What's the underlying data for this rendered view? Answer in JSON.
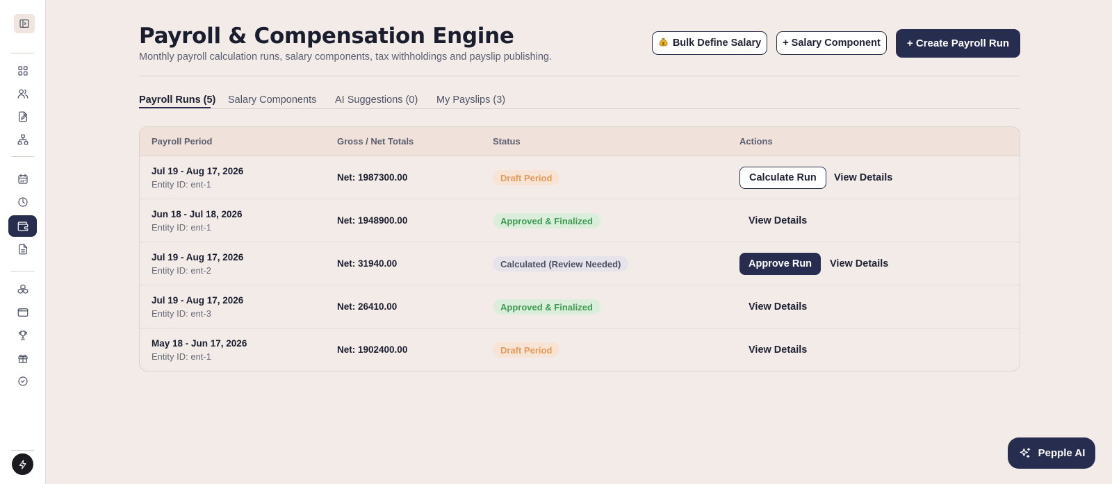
{
  "header": {
    "title": "Payroll & Compensation Engine",
    "subtitle": "Monthly payroll calculation runs, salary components, tax withholdings and payslip publishing.",
    "bulk_define_label": "Bulk Define Salary",
    "bulk_define_icon": "money-bag-icon",
    "salary_component_label": "+ Salary Component",
    "create_run_label": "+ Create Payroll Run"
  },
  "tabs": [
    {
      "label": "Payroll Runs (5)",
      "active": true
    },
    {
      "label": "Salary Components",
      "active": false
    },
    {
      "label": "AI Suggestions (0)",
      "active": false
    },
    {
      "label": "My Payslips (3)",
      "active": false
    }
  ],
  "table": {
    "columns": [
      "Payroll Period",
      "Gross / Net Totals",
      "Status",
      "Actions"
    ],
    "rows": [
      {
        "period": "Jul 19 - Aug 17, 2026",
        "entity": "Entity ID: ent-1",
        "net": "Net: 1987300.00",
        "status": "Draft Period",
        "primary_action": "Calculate Run",
        "view": "View Details"
      },
      {
        "period": "Jun 18 - Jul 18, 2026",
        "entity": "Entity ID: ent-1",
        "net": "Net: 1948900.00",
        "status": "Approved & Finalized",
        "view": "View Details"
      },
      {
        "period": "Jul 19 - Aug 17, 2026",
        "entity": "Entity ID: ent-2",
        "net": "Net: 31940.00",
        "status": "Calculated (Review Needed)",
        "primary_action": "Approve Run",
        "view": "View Details"
      },
      {
        "period": "Jul 19 - Aug 17, 2026",
        "entity": "Entity ID: ent-3",
        "net": "Net: 26410.00",
        "status": "Approved & Finalized",
        "view": "View Details"
      },
      {
        "period": "May 18 - Jun 17, 2026",
        "entity": "Entity ID: ent-1",
        "net": "Net: 1902400.00",
        "status": "Draft Period",
        "view": "View Details"
      }
    ]
  },
  "sidebar": {
    "items": [
      {
        "icon": "dashboard-grid-icon"
      },
      {
        "icon": "users-icon"
      },
      {
        "icon": "file-edit-icon"
      },
      {
        "icon": "org-chart-icon"
      },
      {
        "icon": "calendar-icon"
      },
      {
        "icon": "clock-icon"
      },
      {
        "icon": "wallet-icon",
        "active": true
      },
      {
        "icon": "document-icon"
      },
      {
        "icon": "boxes-icon"
      },
      {
        "icon": "browser-window-icon"
      },
      {
        "icon": "trophy-icon"
      },
      {
        "icon": "gift-icon"
      },
      {
        "icon": "check-circle-icon"
      }
    ]
  },
  "assistant": {
    "label": "Pepple AI",
    "icon": "sparkles-icon"
  },
  "colors": {
    "background": "#f2ebe8",
    "accent": "#262d4f",
    "table_header": "#f0e2da",
    "draft": "#e29a5a",
    "approved": "#3f9a52"
  }
}
